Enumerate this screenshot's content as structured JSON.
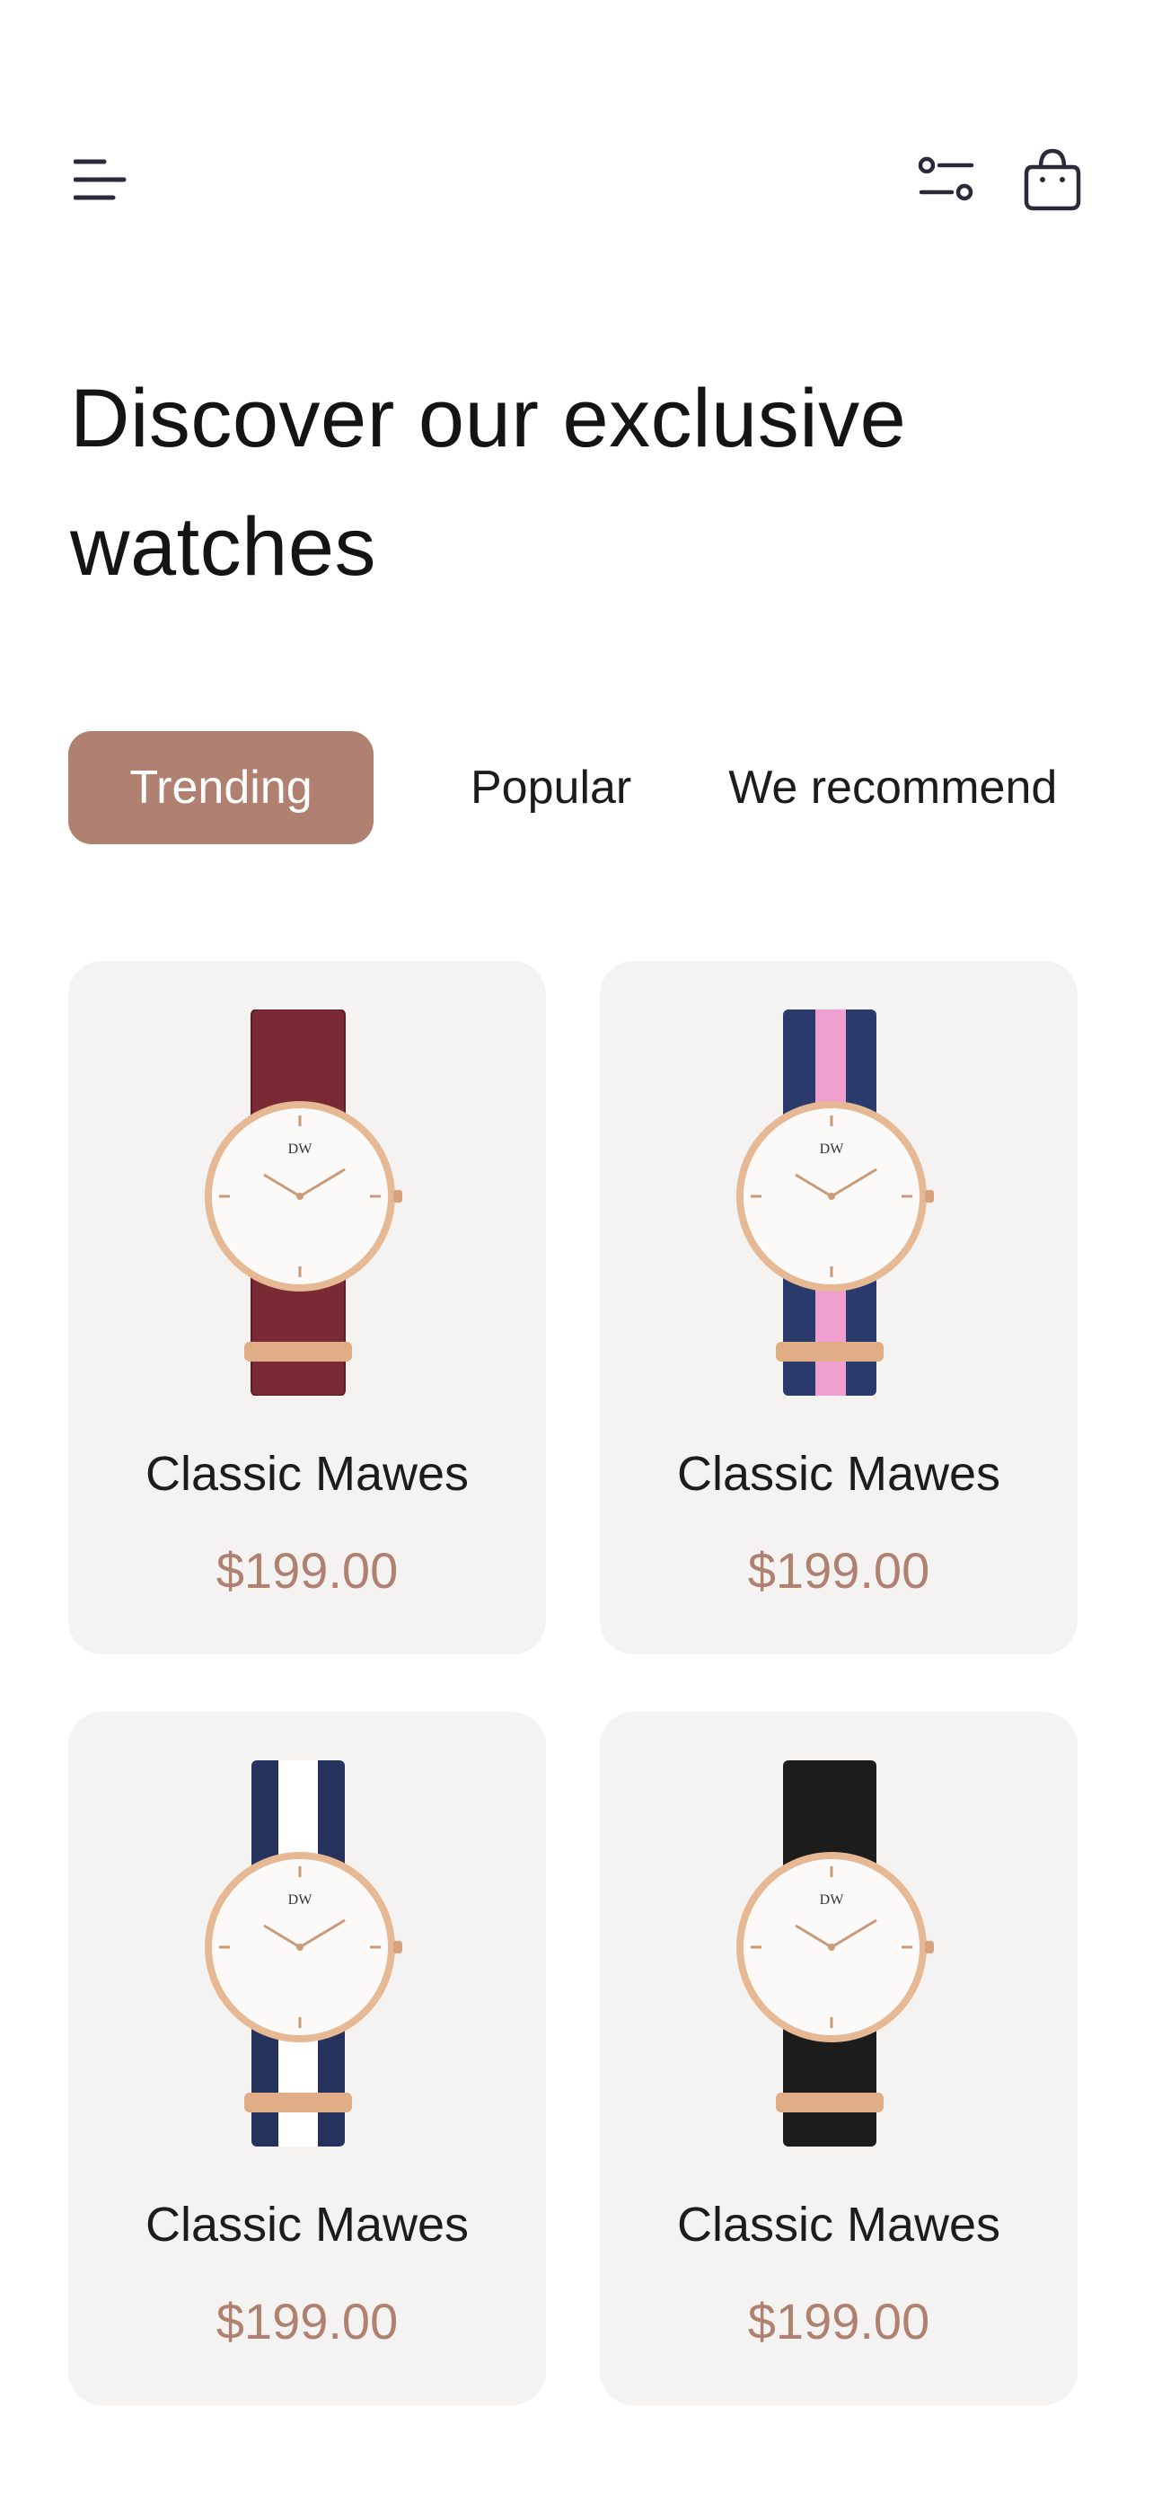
{
  "header": {
    "menu_icon": "menu-lines-icon",
    "filter_icon": "filter-sliders-icon",
    "cart_icon": "shopping-bag-icon"
  },
  "title": "Discover our exclusive watches",
  "tabs": [
    {
      "label": "Trending",
      "active": true
    },
    {
      "label": "Popular",
      "active": false
    },
    {
      "label": "We recommend",
      "active": false
    }
  ],
  "products": [
    {
      "name": "Classic Mawes",
      "price": "$199.00",
      "strap": "burgundy",
      "strap_colors": [
        "#7a2a35"
      ]
    },
    {
      "name": "Classic Mawes",
      "price": "$199.00",
      "strap": "navy-pink",
      "strap_colors": [
        "#2a3a6b",
        "#f0a0d0"
      ]
    },
    {
      "name": "Classic Mawes",
      "price": "$199.00",
      "strap": "navy-white",
      "strap_colors": [
        "#25325c",
        "#ffffff"
      ]
    },
    {
      "name": "Classic Mawes",
      "price": "$199.00",
      "strap": "black",
      "strap_colors": [
        "#1c1c1c"
      ]
    }
  ],
  "dial_brand": "DW",
  "colors": {
    "accent": "#b08070",
    "card_bg": "#f5f3f2",
    "text": "#1c1c1c",
    "rose_gold": "#d7a27c"
  }
}
